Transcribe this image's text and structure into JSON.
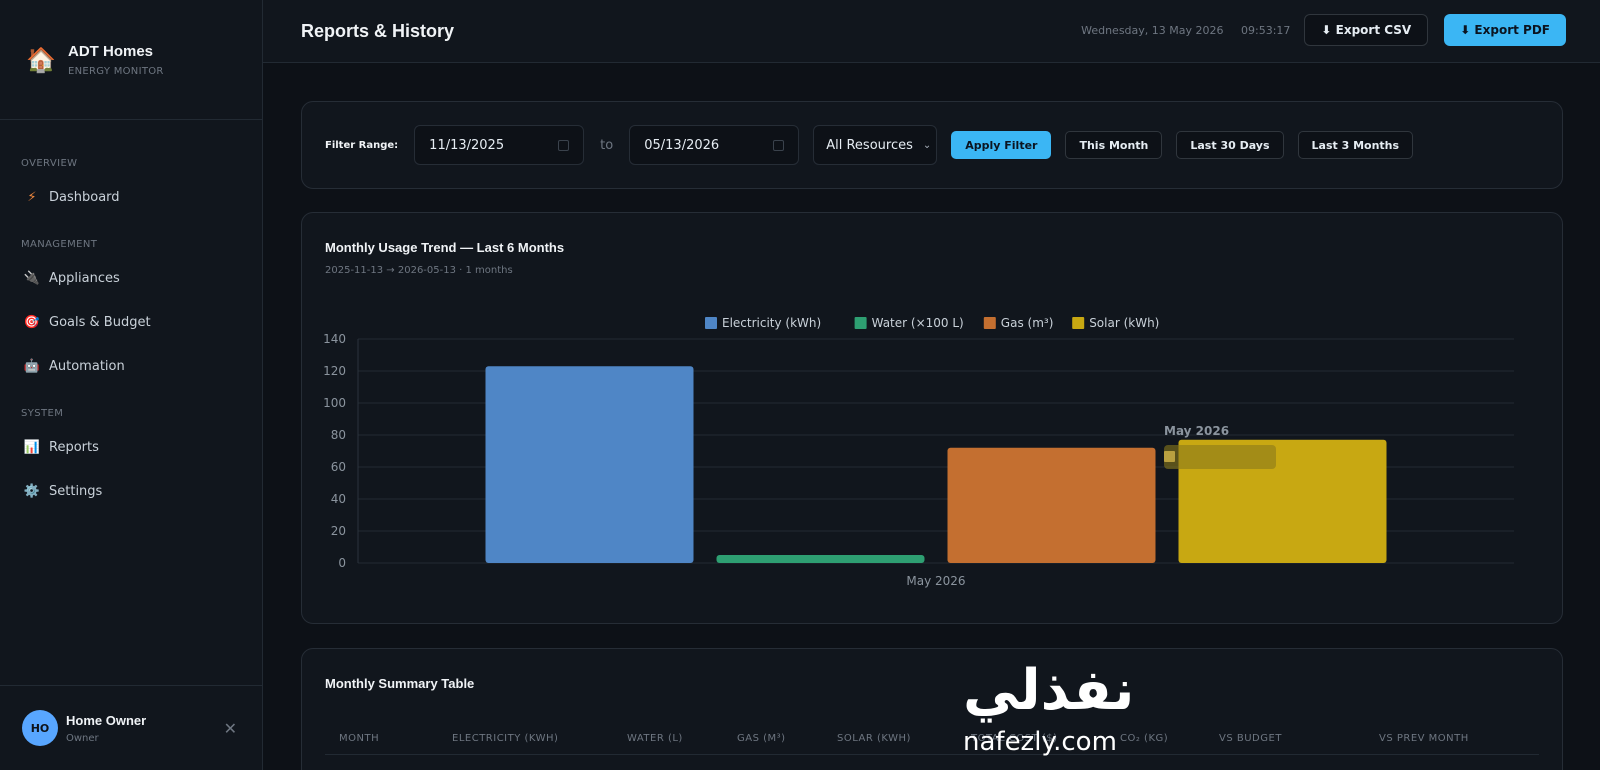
{
  "brand": {
    "title": "ADT Homes",
    "subtitle": "ENERGY MONITOR",
    "logo": "house-icon"
  },
  "sidebar": {
    "sections": [
      {
        "title": "OVERVIEW",
        "items": [
          {
            "label": "Dashboard",
            "icon": "lightning-icon"
          }
        ]
      },
      {
        "title": "MANAGEMENT",
        "items": [
          {
            "label": "Appliances",
            "icon": "plug-icon"
          },
          {
            "label": "Goals & Budget",
            "icon": "target-icon"
          },
          {
            "label": "Automation",
            "icon": "robot-icon"
          }
        ]
      },
      {
        "title": "SYSTEM",
        "items": [
          {
            "label": "Reports",
            "icon": "bar-chart-icon"
          },
          {
            "label": "Settings",
            "icon": "gear-icon"
          }
        ]
      }
    ],
    "active": "Reports"
  },
  "user": {
    "initials": "HO",
    "name": "Home Owner",
    "role": "Owner"
  },
  "header": {
    "title": "Reports & History",
    "date": "Wednesday, 13 May 2026",
    "time": "09:53:17",
    "export_csv": "⬇ Export CSV",
    "export_pdf": "⬇ Export PDF"
  },
  "filter": {
    "label": "Filter Range:",
    "from": "11/13/2025",
    "to_label": "to",
    "to": "05/13/2026",
    "resource": "All Resources",
    "apply": "Apply Filter",
    "presets": [
      "This Month",
      "Last 30 Days",
      "Last 3 Months"
    ]
  },
  "chart": {
    "title": "Monthly Usage Trend — Last 6 Months",
    "subtitle": "2025-11-13 → 2026-05-13 · 1 months",
    "tooltip_title": "May 2026"
  },
  "chart_data": {
    "type": "bar",
    "categories": [
      "May 2026"
    ],
    "series": [
      {
        "name": "Electricity (kWh)",
        "values": [
          123
        ],
        "color": "#4f86c6"
      },
      {
        "name": "Water (×100 L)",
        "values": [
          5
        ],
        "color": "#2e9f72"
      },
      {
        "name": "Gas (m³)",
        "values": [
          72
        ],
        "color": "#c46f30"
      },
      {
        "name": "Solar (kWh)",
        "values": [
          77
        ],
        "color": "#c8a812"
      }
    ],
    "ylim": [
      0,
      140
    ],
    "yticks": [
      0,
      20,
      40,
      60,
      80,
      100,
      120,
      140
    ],
    "grid": true,
    "legend": "top-center"
  },
  "table": {
    "title": "Monthly Summary Table",
    "columns": [
      "MONTH",
      "ELECTRICITY (KWH)",
      "WATER (L)",
      "GAS (M³)",
      "SOLAR (KWH)",
      "TOTAL COST ($)",
      "CO₂ (KG)",
      "VS BUDGET",
      "VS PREV MONTH"
    ]
  },
  "watermark": {
    "arabic": "نفذلي",
    "latin": "nafezly.com"
  }
}
